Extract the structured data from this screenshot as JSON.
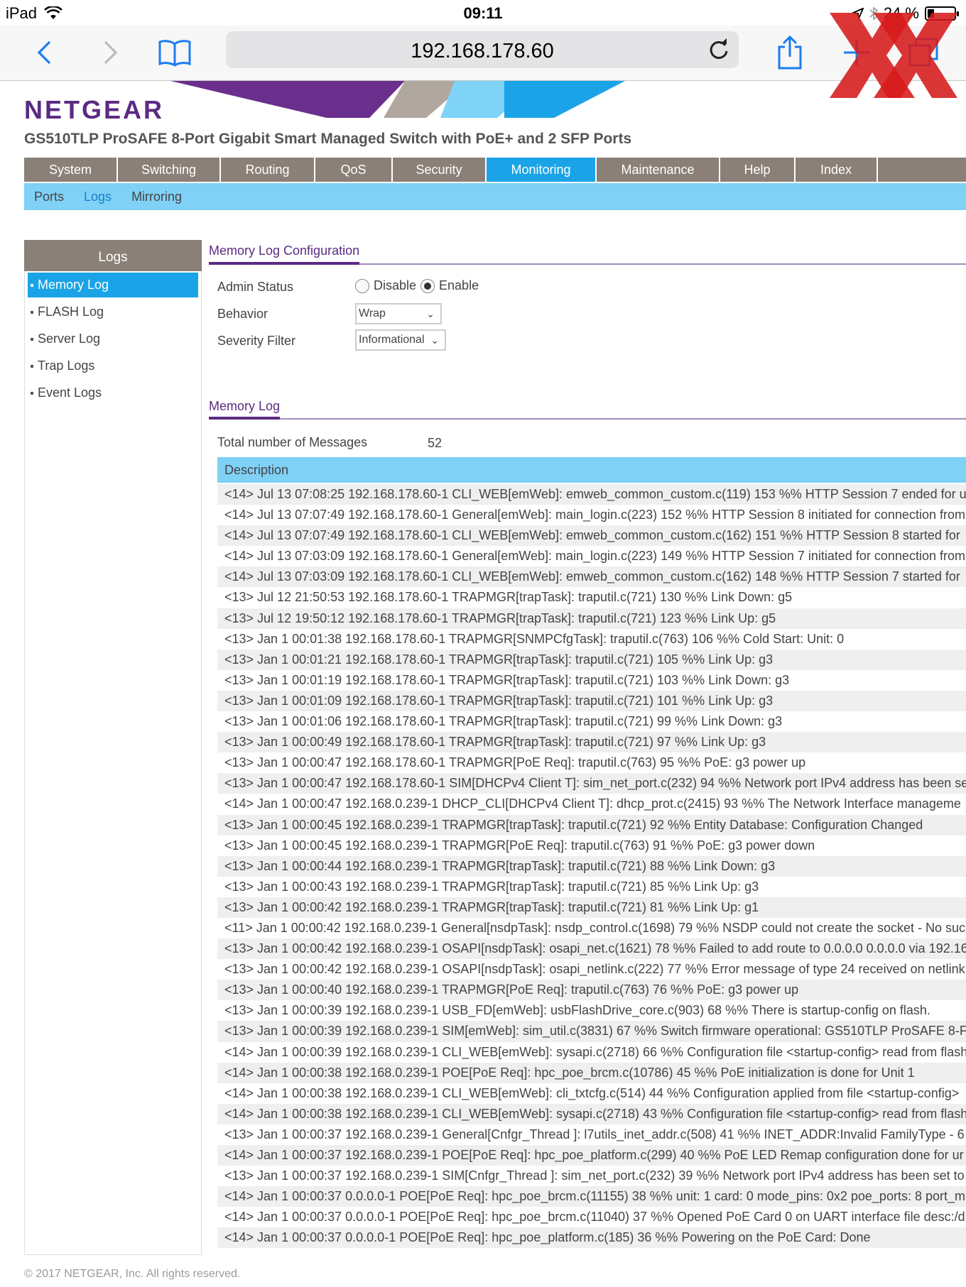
{
  "status_bar": {
    "device": "iPad",
    "time": "09:11",
    "battery_text": "24 %",
    "battery_level": 0.24
  },
  "browser": {
    "url": "192.168.178.60",
    "icons": [
      "back-icon",
      "forward-icon",
      "bookmarks-icon",
      "reload-icon",
      "share-icon",
      "new-tab-icon",
      "tabs-icon"
    ]
  },
  "header": {
    "logo": "NETGEAR",
    "product_title": "GS510TLP ProSAFE 8-Port Gigabit Smart Managed Switch with PoE+ and 2 SFP Ports"
  },
  "main_nav": [
    {
      "label": "System",
      "active": false
    },
    {
      "label": "Switching",
      "active": false
    },
    {
      "label": "Routing",
      "active": false
    },
    {
      "label": "QoS",
      "active": false
    },
    {
      "label": "Security",
      "active": false
    },
    {
      "label": "Monitoring",
      "active": true
    },
    {
      "label": "Maintenance",
      "active": false
    },
    {
      "label": "Help",
      "active": false
    },
    {
      "label": "Index",
      "active": false
    }
  ],
  "sub_nav": [
    {
      "label": "Ports",
      "active": false
    },
    {
      "label": "Logs",
      "active": true
    },
    {
      "label": "Mirroring",
      "active": false
    }
  ],
  "sidebar": {
    "title": "Logs",
    "items": [
      {
        "label": "Memory Log",
        "active": true
      },
      {
        "label": "FLASH Log",
        "active": false
      },
      {
        "label": "Server Log",
        "active": false
      },
      {
        "label": "Trap Logs",
        "active": false
      },
      {
        "label": "Event Logs",
        "active": false
      }
    ]
  },
  "config": {
    "title": "Memory Log Configuration",
    "admin_status_label": "Admin Status",
    "disable_label": "Disable",
    "enable_label": "Enable",
    "admin_status_value": "Enable",
    "behavior_label": "Behavior",
    "behavior_value": "Wrap",
    "severity_label": "Severity Filter",
    "severity_value": "Informational"
  },
  "memory_log": {
    "title": "Memory Log",
    "total_label": "Total number of Messages",
    "total_value": "52",
    "column_header": "Description",
    "rows": [
      "<14> Jul 13 07:08:25 192.168.178.60-1 CLI_WEB[emWeb]: emweb_common_custom.c(119) 153 %% HTTP Session 7 ended for u",
      "<14> Jul 13 07:07:49 192.168.178.60-1 General[emWeb]: main_login.c(223) 152 %% HTTP Session 8 initiated for connection from",
      "<14> Jul 13 07:07:49 192.168.178.60-1 CLI_WEB[emWeb]: emweb_common_custom.c(162) 151 %% HTTP Session 8 started for",
      "<14> Jul 13 07:03:09 192.168.178.60-1 General[emWeb]: main_login.c(223) 149 %% HTTP Session 7 initiated for connection from",
      "<14> Jul 13 07:03:09 192.168.178.60-1 CLI_WEB[emWeb]: emweb_common_custom.c(162) 148 %% HTTP Session 7 started for",
      "<13> Jul 12 21:50:53 192.168.178.60-1 TRAPMGR[trapTask]: traputil.c(721) 130 %% Link Down: g5",
      "<13> Jul 12 19:50:12 192.168.178.60-1 TRAPMGR[trapTask]: traputil.c(721) 123 %% Link Up: g5",
      "<13> Jan 1 00:01:38 192.168.178.60-1 TRAPMGR[SNMPCfgTask]: traputil.c(763) 106 %% Cold Start: Unit: 0",
      "<13> Jan 1 00:01:21 192.168.178.60-1 TRAPMGR[trapTask]: traputil.c(721) 105 %% Link Up: g3",
      "<13> Jan 1 00:01:19 192.168.178.60-1 TRAPMGR[trapTask]: traputil.c(721) 103 %% Link Down: g3",
      "<13> Jan 1 00:01:09 192.168.178.60-1 TRAPMGR[trapTask]: traputil.c(721) 101 %% Link Up: g3",
      "<13> Jan 1 00:01:06 192.168.178.60-1 TRAPMGR[trapTask]: traputil.c(721) 99 %% Link Down: g3",
      "<13> Jan 1 00:00:49 192.168.178.60-1 TRAPMGR[trapTask]: traputil.c(721) 97 %% Link Up: g3",
      "<13> Jan 1 00:00:47 192.168.178.60-1 TRAPMGR[PoE Req]: traputil.c(763) 95 %% PoE: g3 power up",
      "<13> Jan 1 00:00:47 192.168.178.60-1 SIM[DHCPv4 Client T]: sim_net_port.c(232) 94 %% Network port IPv4 address has been se",
      "<14> Jan 1 00:00:47 192.168.0.239-1 DHCP_CLI[DHCPv4 Client T]: dhcp_prot.c(2415) 93 %% The Network Interface manageme",
      "<13> Jan 1 00:00:45 192.168.0.239-1 TRAPMGR[trapTask]: traputil.c(721) 92 %% Entity Database: Configuration Changed",
      "<13> Jan 1 00:00:45 192.168.0.239-1 TRAPMGR[PoE Req]: traputil.c(763) 91 %% PoE: g3 power down",
      "<13> Jan 1 00:00:44 192.168.0.239-1 TRAPMGR[trapTask]: traputil.c(721) 88 %% Link Down: g3",
      "<13> Jan 1 00:00:43 192.168.0.239-1 TRAPMGR[trapTask]: traputil.c(721) 85 %% Link Up: g3",
      "<13> Jan 1 00:00:42 192.168.0.239-1 TRAPMGR[trapTask]: traputil.c(721) 81 %% Link Up: g1",
      "<11> Jan 1 00:00:42 192.168.0.239-1 General[nsdpTask]: nsdp_control.c(1698) 79 %% NSDP could not create the socket - No suc",
      "<13> Jan 1 00:00:42 192.168.0.239-1 OSAPI[nsdpTask]: osapi_net.c(1621) 78 %% Failed to add route to 0.0.0.0 0.0.0.0 via 192.16",
      "<13> Jan 1 00:00:42 192.168.0.239-1 OSAPI[nsdpTask]: osapi_netlink.c(222) 77 %% Error message of type 24 received on netlink",
      "<13> Jan 1 00:00:40 192.168.0.239-1 TRAPMGR[PoE Req]: traputil.c(763) 76 %% PoE: g3 power up",
      "<13> Jan 1 00:00:39 192.168.0.239-1 USB_FD[emWeb]: usbFlashDrive_core.c(903) 68 %% There is startup-config on flash.",
      "<13> Jan 1 00:00:39 192.168.0.239-1 SIM[emWeb]: sim_util.c(3831) 67 %% Switch firmware operational: GS510TLP ProSAFE 8-F",
      "<14> Jan 1 00:00:39 192.168.0.239-1 CLI_WEB[emWeb]: sysapi.c(2718) 66 %% Configuration file <startup-config> read from flash",
      "<14> Jan 1 00:00:38 192.168.0.239-1 POE[PoE Req]: hpc_poe_brcm.c(10786) 45 %% PoE initialization is done for Unit 1",
      "<14> Jan 1 00:00:38 192.168.0.239-1 CLI_WEB[emWeb]: cli_txtcfg.c(514) 44 %% Configuration applied from file <startup-config>",
      "<14> Jan 1 00:00:38 192.168.0.239-1 CLI_WEB[emWeb]: sysapi.c(2718) 43 %% Configuration file <startup-config> read from flash",
      "<13> Jan 1 00:00:37 192.168.0.239-1 General[Cnfgr_Thread ]: l7utils_inet_addr.c(508) 41 %% INET_ADDR:Invalid FamilyType - 6",
      "<14> Jan 1 00:00:37 192.168.0.239-1 POE[PoE Req]: hpc_poe_platform.c(299) 40 %% PoE LED Remap configuration done for ur",
      "<13> Jan 1 00:00:37 192.168.0.239-1 SIM[Cnfgr_Thread ]: sim_net_port.c(232) 39 %% Network port IPv4 address has been set to",
      "<14> Jan 1 00:00:37 0.0.0.0-1 POE[PoE Req]: hpc_poe_brcm.c(11155) 38 %% unit: 1 card: 0 mode_pins: 0x2 poe_ports: 8 port_m",
      "<14> Jan 1 00:00:37 0.0.0.0-1 POE[PoE Req]: hpc_poe_brcm.c(11040) 37 %% Opened PoE Card 0 on UART interface file desc:/d",
      "<14> Jan 1 00:00:37 0.0.0.0-1 POE[PoE Req]: hpc_poe_platform.c(185) 36 %% Powering on the PoE Card: Done"
    ]
  },
  "footer": "© 2017 NETGEAR, Inc. All rights reserved.",
  "colors": {
    "brand_purple": "#5b2b82",
    "nav_gray": "#8a8077",
    "active_blue": "#1aa4e7",
    "sub_nav_blue": "#7fd1f6"
  }
}
